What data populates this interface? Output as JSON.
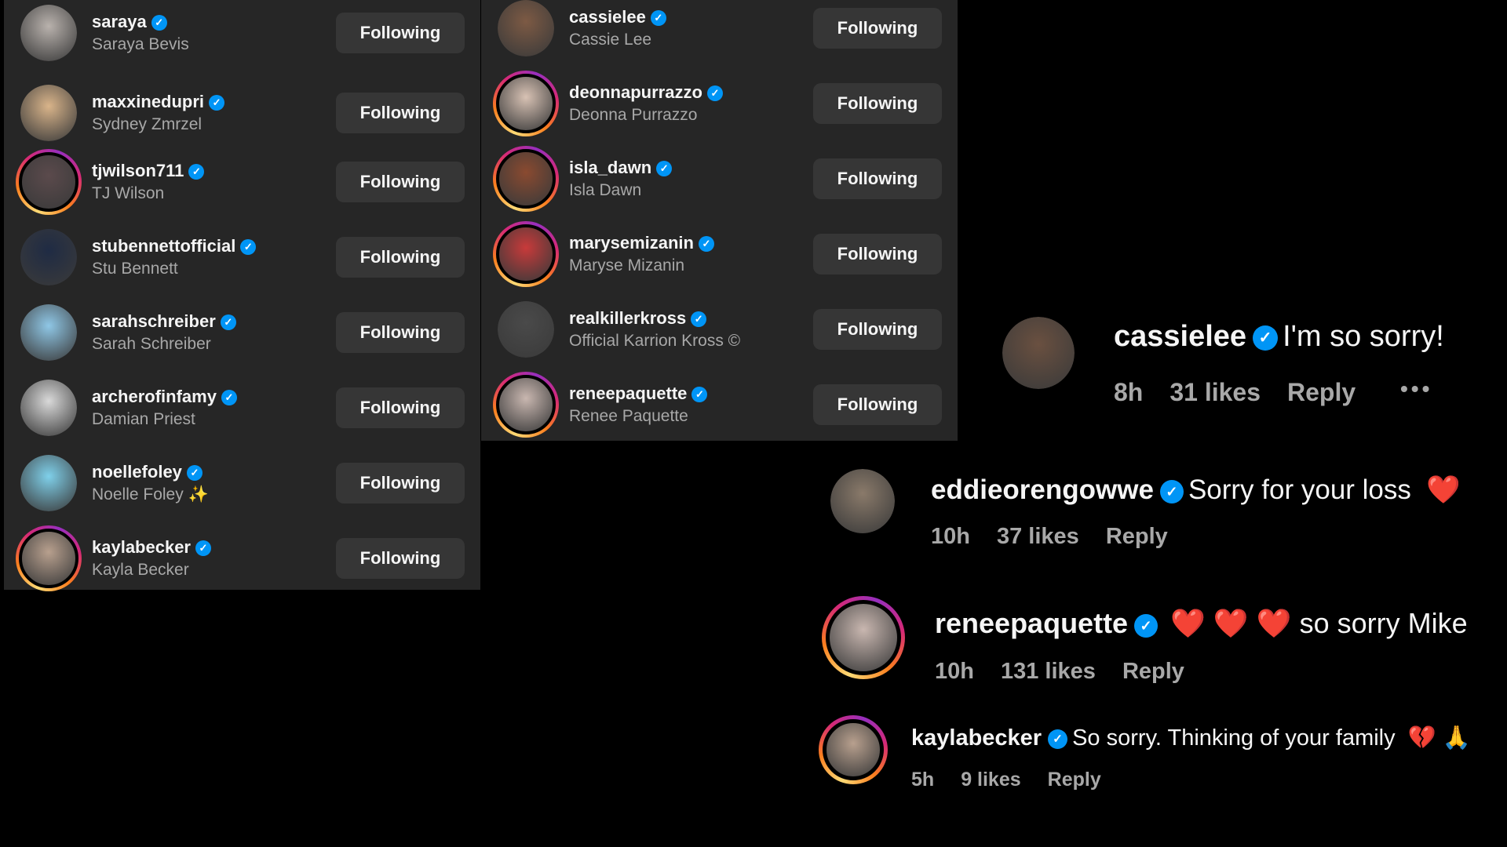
{
  "following_list_left": [
    {
      "username": "saraya",
      "name": "Saraya Bevis",
      "button": "Following",
      "ring": false,
      "avatar_color": "#b9b2ad"
    },
    {
      "username": "maxxinedupri",
      "name": "Sydney Zmrzel",
      "button": "Following",
      "ring": false,
      "avatar_color": "#d9b48a"
    },
    {
      "username": "tjwilson711",
      "name": "TJ Wilson",
      "button": "Following",
      "ring": true,
      "avatar_color": "#5b4a4c"
    },
    {
      "username": "stubennettofficial",
      "name": "Stu Bennett",
      "button": "Following",
      "ring": false,
      "avatar_color": "#1f2b44"
    },
    {
      "username": "sarahschreiber",
      "name": "Sarah Schreiber",
      "button": "Following",
      "ring": false,
      "avatar_color": "#8fc7e6"
    },
    {
      "username": "archerofinfamy",
      "name": "Damian Priest",
      "button": "Following",
      "ring": false,
      "avatar_color": "#d9d9d9"
    },
    {
      "username": "noellefoley",
      "name": "Noelle Foley",
      "name_emoji": "✨",
      "button": "Following",
      "ring": false,
      "avatar_color": "#7fd0ea"
    },
    {
      "username": "kaylabecker",
      "name": "Kayla Becker",
      "button": "Following",
      "ring": true,
      "avatar_color": "#b8a08e"
    }
  ],
  "following_list_right": [
    {
      "username": "cassielee",
      "name": "Cassie Lee",
      "button": "Following",
      "ring": false,
      "avatar_color": "#7d5a44"
    },
    {
      "username": "deonnapurrazzo",
      "name": "Deonna Purrazzo",
      "button": "Following",
      "ring": true,
      "avatar_color": "#d8c2b4"
    },
    {
      "username": "isla_dawn",
      "name": "Isla Dawn",
      "button": "Following",
      "ring": true,
      "avatar_color": "#8a4a30"
    },
    {
      "username": "marysemizanin",
      "name": "Maryse Mizanin",
      "button": "Following",
      "ring": true,
      "avatar_color": "#c83a3a"
    },
    {
      "username": "realkillerkross",
      "name": "Official Karrion Kross ©",
      "button": "Following",
      "ring": false,
      "avatar_color": "#4a4a4a"
    },
    {
      "username": "reneepaquette",
      "name": "Renee Paquette",
      "button": "Following",
      "ring": true,
      "avatar_color": "#c9b7b0"
    }
  ],
  "comments": [
    {
      "username": "cassielee",
      "text": "I'm so sorry!",
      "time": "8h",
      "likes": "31 likes",
      "reply": "Reply",
      "more": "•••",
      "ring": false,
      "avatar_color": "#6a5040"
    },
    {
      "username": "eddieorengowwe",
      "text": "Sorry for your loss",
      "emoji": "❤️",
      "time": "10h",
      "likes": "37 likes",
      "reply": "Reply",
      "ring": false,
      "avatar_color": "#8a7a6a"
    },
    {
      "username": "reneepaquette",
      "emoji_prefix": "❤️ ❤️ ❤️",
      "text": "so sorry Mike",
      "time": "10h",
      "likes": "131 likes",
      "reply": "Reply",
      "ring": true,
      "avatar_color": "#c9b7b0"
    },
    {
      "username": "kaylabecker",
      "text": "So sorry. Thinking of your family",
      "emoji": "💔 🙏",
      "time": "5h",
      "likes": "9 likes",
      "reply": "Reply",
      "ring": true,
      "avatar_color": "#b8a08e"
    }
  ],
  "colors": {
    "accent": "#0095f6",
    "button_bg": "#363636",
    "panel_bg": "#262626",
    "secondary_text": "#a8a8a8",
    "heart": "#ed1c24"
  }
}
